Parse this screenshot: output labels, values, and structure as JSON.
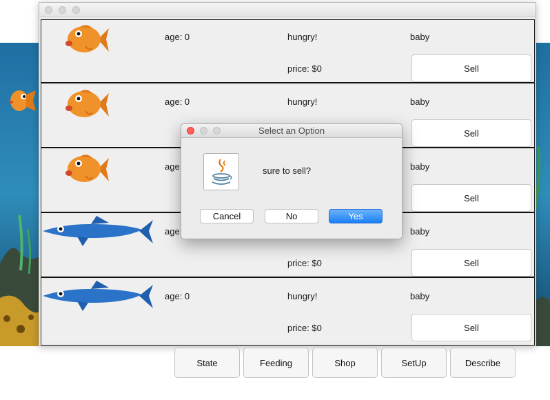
{
  "dialog": {
    "title": "Select an Option",
    "message": "sure to sell?",
    "icon": "java-coffee-icon",
    "buttons": {
      "cancel": "Cancel",
      "no": "No",
      "yes": "Yes"
    }
  },
  "fish": [
    {
      "kind": "goldfish",
      "age": "age: 0",
      "status": "hungry!",
      "stage": "baby",
      "price": "price: $0",
      "sell": "Sell"
    },
    {
      "kind": "goldfish",
      "age": "age: 0",
      "status": "hungry!",
      "stage": "baby",
      "price": "",
      "sell": "Sell"
    },
    {
      "kind": "goldfish",
      "age": "age:",
      "status": "",
      "stage": "baby",
      "price": "",
      "sell": "Sell"
    },
    {
      "kind": "needlefish",
      "age": "age:",
      "status": "",
      "stage": "baby",
      "price": "price: $0",
      "sell": "Sell"
    },
    {
      "kind": "needlefish",
      "age": "age: 0",
      "status": "hungry!",
      "stage": "baby",
      "price": "price: $0",
      "sell": "Sell"
    }
  ],
  "nav": {
    "state": "State",
    "feeding": "Feeding",
    "shop": "Shop",
    "setup": "SetUp",
    "describe": "Describe"
  },
  "colors": {
    "close": "#fe5f57",
    "accent": "#1a7ff5",
    "goldfish": "#f0922a",
    "needlefish": "#2b73c9"
  }
}
